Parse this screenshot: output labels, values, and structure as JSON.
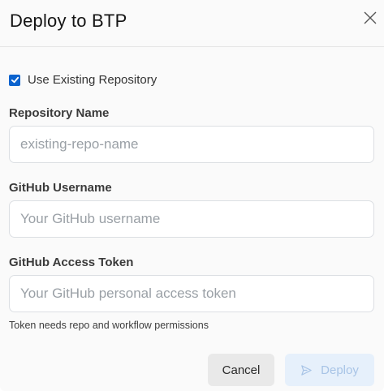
{
  "dialog": {
    "title": "Deploy to BTP",
    "close_icon": "close-icon"
  },
  "use_existing": {
    "label": "Use Existing Repository",
    "checked": true
  },
  "repository_name": {
    "label": "Repository Name",
    "placeholder": "existing-repo-name",
    "value": ""
  },
  "github_username": {
    "label": "GitHub Username",
    "placeholder": "Your GitHub username",
    "value": ""
  },
  "github_token": {
    "label": "GitHub Access Token",
    "placeholder": "Your GitHub personal access token",
    "value": "",
    "hint": "Token needs repo and workflow permissions"
  },
  "actions": {
    "cancel_label": "Cancel",
    "deploy_label": "Deploy",
    "deploy_icon": "send-icon",
    "deploy_disabled": true
  },
  "colors": {
    "accent": "#0b63ce",
    "deploy_bg": "#e6f0fb",
    "deploy_text": "#a8c4e6",
    "cancel_bg": "#e9e9e9"
  }
}
